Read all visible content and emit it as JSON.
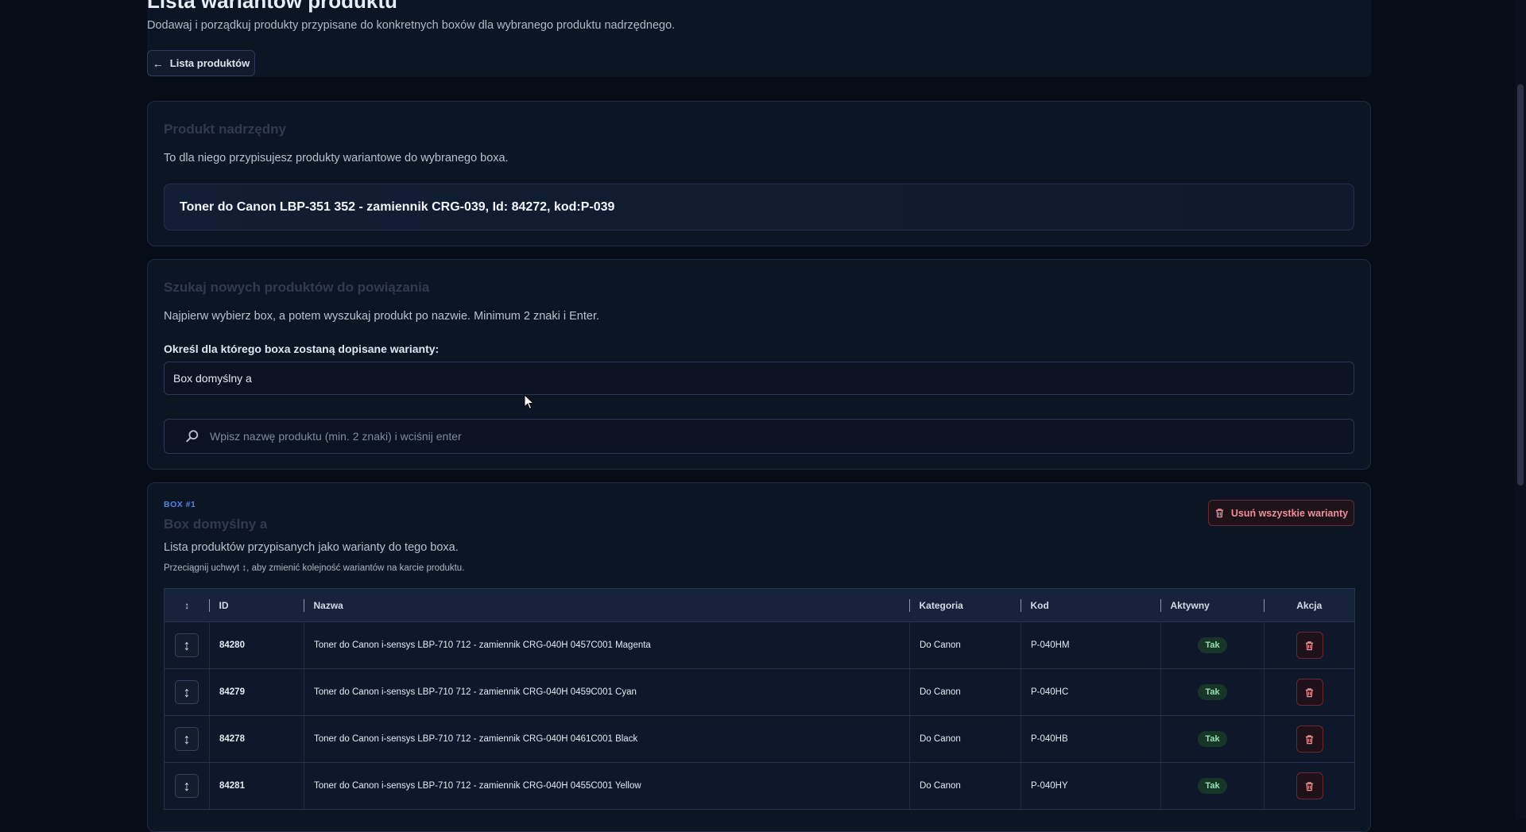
{
  "header": {
    "title": "Lista wariantów produktu",
    "subtitle": "Dodawaj i porządkuj produkty przypisane do konkretnych boxów dla wybranego produktu nadrzędnego.",
    "back_label": "Lista produktów"
  },
  "parent": {
    "title": "Produkt nadrzędny",
    "desc": "To dla niego przypisujesz produkty wariantowe do wybranego boxa.",
    "product": "Toner do Canon LBP-351 352 - zamiennik CRG-039, Id: 84272, kod:P-039"
  },
  "search": {
    "title": "Szukaj nowych produktów do powiązania",
    "desc": "Najpierw wybierz box, a potem wyszukaj produkt po nazwie. Minimum 2 znaki i Enter.",
    "box_label": "Określ dla którego boxa zostaną dopisane warianty:",
    "box_value": "Box domyślny a",
    "placeholder": "Wpisz nazwę produktu (min. 2 znaki) i wciśnij enter"
  },
  "box": {
    "tag": "BOX #1",
    "name": "Box domyślny a",
    "desc": "Lista produktów przypisanych jako warianty do tego boxa.",
    "hint": "Przeciągnij uchwyt ↕, aby zmienić kolejność wariantów na karcie produktu.",
    "delete_all_label": "Usuń wszystkie warianty"
  },
  "table": {
    "headers": {
      "handle": "↕",
      "id": "ID",
      "name": "Nazwa",
      "category": "Kategoria",
      "code": "Kod",
      "active": "Aktywny",
      "action": "Akcja"
    },
    "rows": [
      {
        "id": "84280",
        "name": "Toner do Canon i-sensys LBP-710 712 - zamiennik CRG-040H 0457C001 Magenta",
        "category": "Do Canon",
        "code": "P-040HM",
        "active": "Tak"
      },
      {
        "id": "84279",
        "name": "Toner do Canon i-sensys LBP-710 712 - zamiennik CRG-040H 0459C001 Cyan",
        "category": "Do Canon",
        "code": "P-040HC",
        "active": "Tak"
      },
      {
        "id": "84278",
        "name": "Toner do Canon i-sensys LBP-710 712 - zamiennik CRG-040H 0461C001 Black",
        "category": "Do Canon",
        "code": "P-040HB",
        "active": "Tak"
      },
      {
        "id": "84281",
        "name": "Toner do Canon i-sensys LBP-710 712 - zamiennik CRG-040H 0455C001 Yellow",
        "category": "Do Canon",
        "code": "P-040HY",
        "active": "Tak"
      }
    ]
  },
  "icons": {
    "back": "arrow-left-icon",
    "search": "search-icon",
    "trash": "trash-icon",
    "drag": "drag-handle-icon"
  },
  "colors": {
    "accent": "#4f86e8",
    "danger": "#f08f9c",
    "success": "#8fe3b0"
  }
}
